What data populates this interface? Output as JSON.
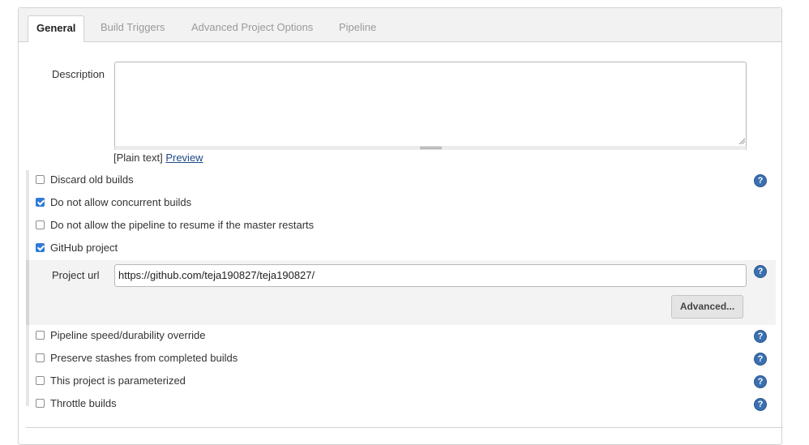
{
  "tabs": [
    {
      "label": "General"
    },
    {
      "label": "Build Triggers"
    },
    {
      "label": "Advanced Project Options"
    },
    {
      "label": "Pipeline"
    }
  ],
  "description": {
    "label": "Description",
    "value": "",
    "format_text": "[Plain text]",
    "preview_link": "Preview"
  },
  "options": [
    {
      "label": "Discard old builds",
      "checked": false
    },
    {
      "label": "Do not allow concurrent builds",
      "checked": true
    },
    {
      "label": "Do not allow the pipeline to resume if the master restarts",
      "checked": false
    },
    {
      "label": "GitHub project",
      "checked": true
    },
    {
      "label": "Pipeline speed/durability override",
      "checked": false
    },
    {
      "label": "Preserve stashes from completed builds",
      "checked": false
    },
    {
      "label": "This project is parameterized",
      "checked": false
    },
    {
      "label": "Throttle builds",
      "checked": false
    }
  ],
  "github": {
    "project_url_label": "Project url",
    "project_url_value": "https://github.com/teja190827/teja190827/",
    "advanced_button": "Advanced..."
  },
  "help_icon": "?",
  "colors": {
    "accent": "#2f7bd6",
    "help_icon": "#3a6fb0",
    "link": "#204a87"
  }
}
